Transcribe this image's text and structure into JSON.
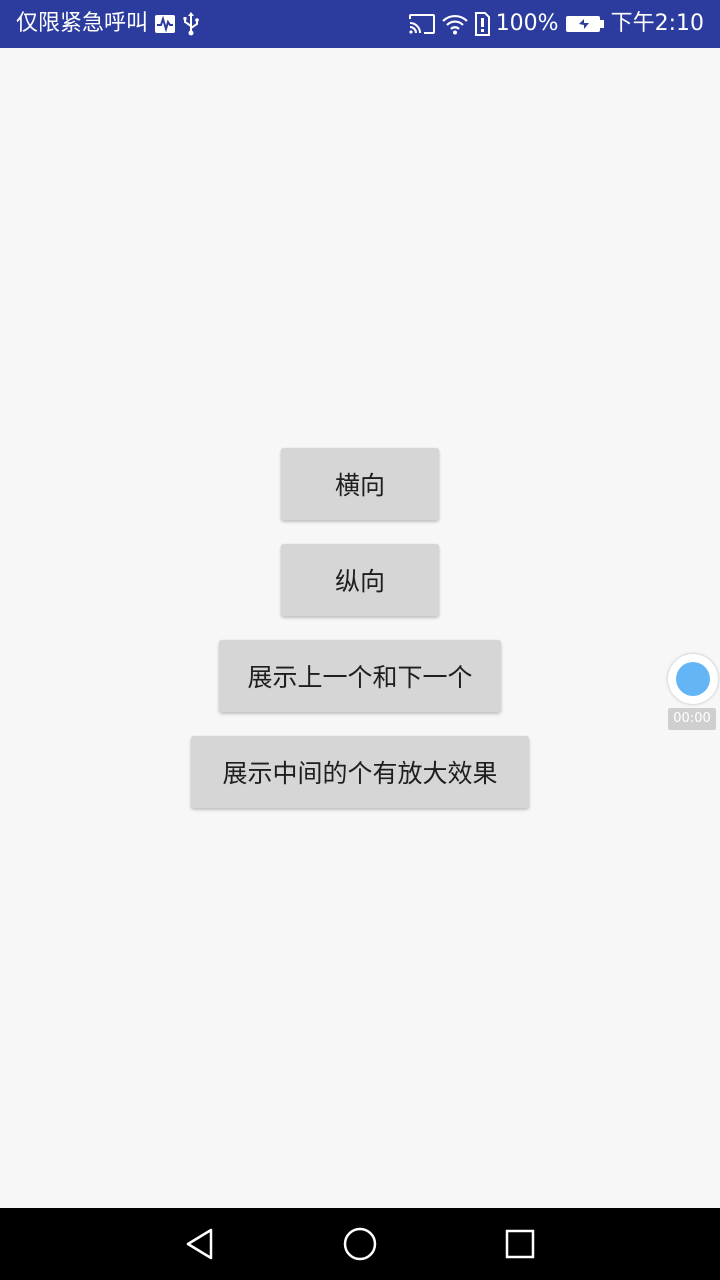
{
  "status_bar": {
    "carrier_text": "仅限紧急呼叫",
    "battery_text": "100%",
    "time": "下午2:10",
    "icons": [
      "activity-icon",
      "usb-icon",
      "cast-icon",
      "wifi-icon",
      "alert-icon",
      "battery-charging-icon"
    ]
  },
  "buttons": {
    "horizontal": "横向",
    "vertical": "纵向",
    "prev_next": "展示上一个和下一个",
    "center_zoom": "展示中间的个有放大效果"
  },
  "recorder": {
    "time": "00:00"
  },
  "nav": {
    "icons": [
      "back-icon",
      "home-icon",
      "recents-icon"
    ]
  },
  "colors": {
    "status_bar": "#2c3c9e",
    "background": "#f7f7f7",
    "button": "#d6d6d6",
    "recorder_accent": "#64b5f6",
    "nav_bar": "#000000"
  }
}
